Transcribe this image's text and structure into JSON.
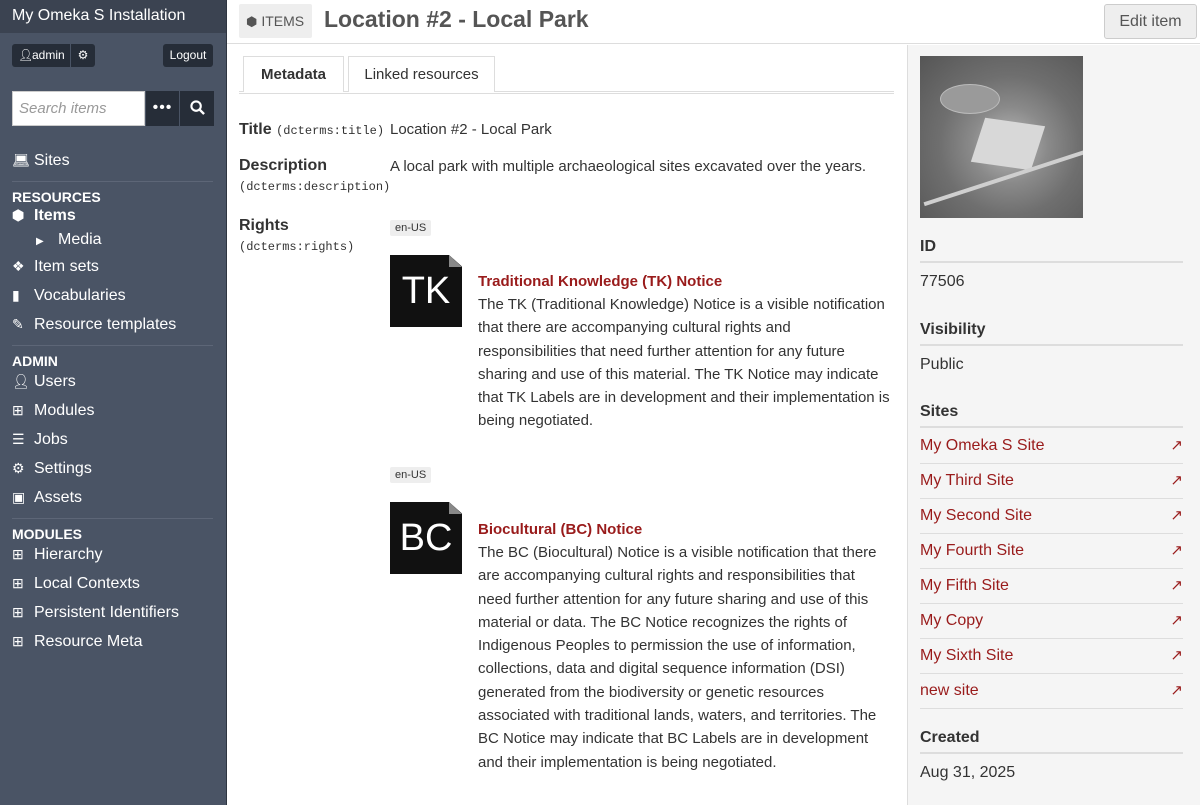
{
  "app": {
    "installation_title": "My Omeka S Installation"
  },
  "user": {
    "name": "admin",
    "logout_label": "Logout"
  },
  "search": {
    "placeholder": "Search items"
  },
  "nav": {
    "sites": "Sites",
    "resources_heading": "RESOURCES",
    "items": "Items",
    "media": "Media",
    "item_sets": "Item sets",
    "vocabularies": "Vocabularies",
    "resource_templates": "Resource templates",
    "admin_heading": "ADMIN",
    "users": "Users",
    "modules": "Modules",
    "jobs": "Jobs",
    "settings": "Settings",
    "assets": "Assets",
    "modules_heading": "MODULES",
    "hierarchy": "Hierarchy",
    "local_contexts": "Local Contexts",
    "persistent_identifiers": "Persistent Identifiers",
    "resource_meta": "Resource Meta"
  },
  "header": {
    "type_badge": "ITEMS",
    "title": "Location #2 - Local Park",
    "edit_label": "Edit item"
  },
  "tabs": {
    "metadata": "Metadata",
    "linked": "Linked resources"
  },
  "properties": {
    "title": {
      "label": "Title",
      "term": "(dcterms:title)",
      "value": "Location #2 - Local Park"
    },
    "description": {
      "label": "Description",
      "term": "(dcterms:description)",
      "value": "A local park with multiple archaeological sites excavated over the years."
    },
    "rights": {
      "label": "Rights",
      "term": "(dcterms:rights)"
    }
  },
  "notices": [
    {
      "lang": "en-US",
      "image_text": "TK",
      "title": "Traditional Knowledge (TK) Notice",
      "text": "The TK (Traditional Knowledge) Notice is a visible notification that there are accompanying cultural rights and responsibilities that need further attention for any future sharing and use of this material. The TK Notice may indicate that TK Labels are in development and their implementation is being negotiated."
    },
    {
      "lang": "en-US",
      "image_text": "BC",
      "title": "Biocultural (BC) Notice",
      "text": "The BC (Biocultural) Notice is a visible notification that there are accompanying cultural rights and responsibilities that need further attention for any future sharing and use of this material or data. The BC Notice recognizes the rights of Indigenous Peoples to permission the use of information, collections, data and digital sequence information (DSI) generated from the biodiversity or genetic resources associated with traditional lands, waters, and territories. The BC Notice may indicate that BC Labels are in development and their implementation is being negotiated."
    }
  ],
  "panel": {
    "id_label": "ID",
    "id_value": "77506",
    "visibility_label": "Visibility",
    "visibility_value": "Public",
    "sites_label": "Sites",
    "sites": [
      "My Omeka S Site",
      "My Third Site",
      "My Second Site",
      "My Fourth Site",
      "My Fifth Site",
      "My Copy",
      "My Sixth Site",
      "new site"
    ],
    "created_label": "Created",
    "created_value": "Aug 31, 2025"
  },
  "colors": {
    "sidebar": "#4a5465",
    "link": "#991b1b"
  }
}
